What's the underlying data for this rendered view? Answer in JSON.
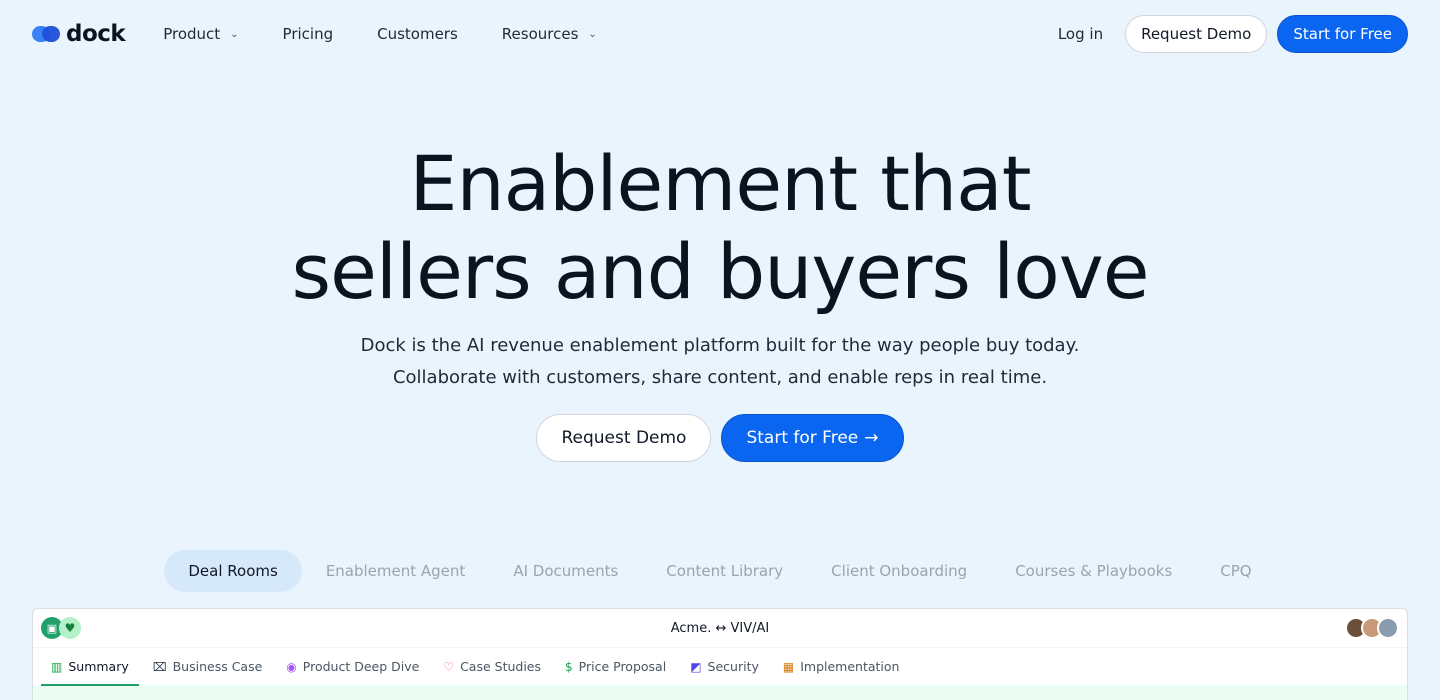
{
  "brand": {
    "name": "dock"
  },
  "nav": {
    "links": [
      {
        "label": "Product",
        "has_dropdown": true
      },
      {
        "label": "Pricing",
        "has_dropdown": false
      },
      {
        "label": "Customers",
        "has_dropdown": false
      },
      {
        "label": "Resources",
        "has_dropdown": true
      }
    ],
    "login": "Log in",
    "request_demo": "Request Demo",
    "start_free": "Start for Free"
  },
  "hero": {
    "title_line1": "Enablement that",
    "title_line2": "sellers and buyers love",
    "subtitle_line1": "Dock is the AI revenue enablement platform built for the way people buy today.",
    "subtitle_line2": "Collaborate with customers, share content, and enable reps in real time.",
    "cta_secondary": "Request Demo",
    "cta_primary": "Start for Free",
    "cta_arrow": "→"
  },
  "feature_tabs": [
    {
      "label": "Deal Rooms",
      "active": true
    },
    {
      "label": "Enablement Agent",
      "active": false
    },
    {
      "label": "AI Documents",
      "active": false
    },
    {
      "label": "Content Library",
      "active": false
    },
    {
      "label": "Client Onboarding",
      "active": false
    },
    {
      "label": "Courses & Playbooks",
      "active": false
    },
    {
      "label": "CPQ",
      "active": false
    }
  ],
  "preview": {
    "title": "Acme. ↔ VIV/AI",
    "tabs": [
      {
        "label": "Summary",
        "icon": "book-icon",
        "glyph": "▥",
        "color": "#16a34a",
        "active": true
      },
      {
        "label": "Business Case",
        "icon": "briefcase-icon",
        "glyph": "⌧",
        "color": "#374151",
        "active": false
      },
      {
        "label": "Product Deep Dive",
        "icon": "compass-icon",
        "glyph": "◉",
        "color": "#a855f7",
        "active": false
      },
      {
        "label": "Case Studies",
        "icon": "heart-icon",
        "glyph": "♡",
        "color": "#ec4899",
        "active": false
      },
      {
        "label": "Price Proposal",
        "icon": "dollar-icon",
        "glyph": "$",
        "color": "#16a34a",
        "active": false
      },
      {
        "label": "Security",
        "icon": "shield-icon",
        "glyph": "◩",
        "color": "#4f46e5",
        "active": false
      },
      {
        "label": "Implementation",
        "icon": "map-icon",
        "glyph": "▦",
        "color": "#d97706",
        "active": false
      }
    ]
  },
  "colors": {
    "primary": "#0a66f0",
    "background": "#eaf4fd",
    "active_tab": "#d6e9fb",
    "accent_green": "#22a06b"
  }
}
